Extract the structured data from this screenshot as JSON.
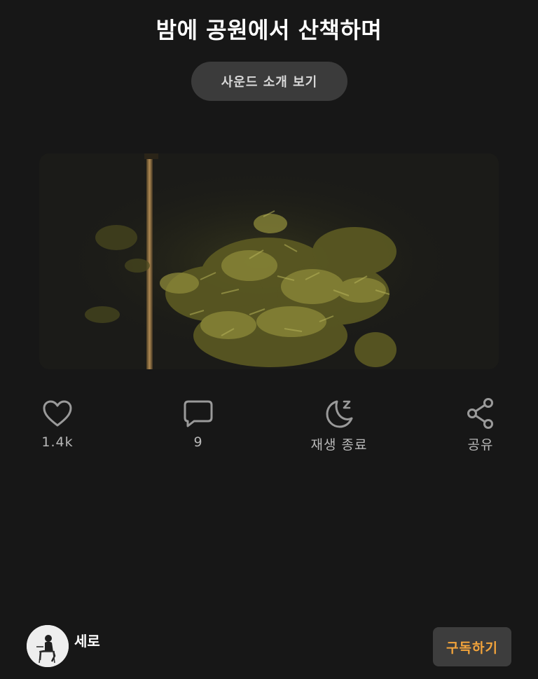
{
  "header": {
    "title": "밤에 공원에서 산책하며",
    "intro_button_label": "사운드 소개 보기"
  },
  "actions": {
    "like": {
      "icon": "heart-icon",
      "label": "1.4k"
    },
    "comment": {
      "icon": "comment-icon",
      "label": "9"
    },
    "sleep_timer": {
      "icon": "moon-sleep-icon",
      "label": "재생 종료"
    },
    "share": {
      "icon": "share-icon",
      "label": "공유"
    }
  },
  "author": {
    "name": "세로",
    "subscribe_label": "구독하기"
  },
  "colors": {
    "background": "#171717",
    "accent": "#f3a43b",
    "button_bg": "#3b3b3b",
    "label_gray": "#b8b8b8"
  }
}
